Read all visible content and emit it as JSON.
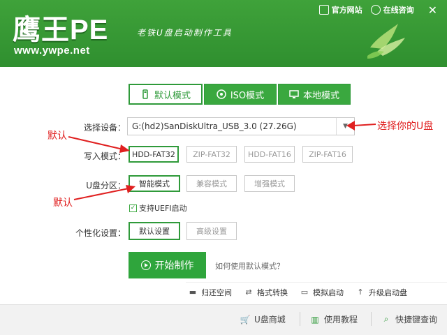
{
  "header": {
    "logo": "鹰王PE",
    "url": "www.ywpe.net",
    "slogan": "老铁U盘启动制作工具",
    "official_site": "官方网站",
    "online_consult": "在线咨询",
    "close": "✕"
  },
  "tabs": [
    {
      "label": "默认模式",
      "icon": "usb-icon",
      "active": true
    },
    {
      "label": "ISO模式",
      "icon": "disc-icon",
      "active": false
    },
    {
      "label": "本地模式",
      "icon": "monitor-icon",
      "active": false
    }
  ],
  "device": {
    "label": "选择设备：",
    "value": "G:(hd2)SanDiskUltra_USB_3.0 (27.26G)"
  },
  "write_mode": {
    "label": "写入模式：",
    "options": [
      "HDD-FAT32",
      "ZIP-FAT32",
      "HDD-FAT16",
      "ZIP-FAT16"
    ],
    "selected": "HDD-FAT32"
  },
  "partition": {
    "label": "U盘分区：",
    "options": [
      "智能模式",
      "兼容模式",
      "增强模式"
    ],
    "selected": "智能模式",
    "uefi_label": "支持UEFI启动",
    "uefi_checked": true
  },
  "personalize": {
    "label": "个性化设置：",
    "options": [
      "默认设置",
      "高级设置"
    ],
    "selected": "默认设置"
  },
  "start": {
    "button": "开始制作",
    "help": "如何使用默认模式？"
  },
  "tools": [
    "归还空间",
    "格式转换",
    "模拟启动",
    "升级启动盘"
  ],
  "footer": [
    "U盘商城",
    "使用教程",
    "快捷键查询"
  ],
  "annotations": {
    "default1": "默认",
    "default2": "默认",
    "choose_usb": "选择你的U盘"
  },
  "colors": {
    "brand_green": "#2fa53c",
    "annotation_red": "#e02020"
  }
}
